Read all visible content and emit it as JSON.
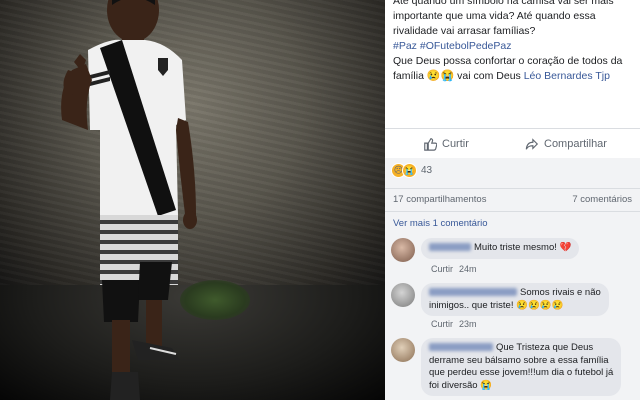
{
  "post": {
    "line1": "Até quando um símbolo na camisa vai ser mais",
    "line2": "importante que uma vida? Até quando essa",
    "line3": "rivalidade vai arrasar famílias?",
    "hashtags": "#Paz #OFutebolPedePaz",
    "line5": "Que Deus possa confortar o coração de todos da",
    "line6_prefix": "família",
    "line6_emojis": "😢😭",
    "line6_mid": " vai com Deus ",
    "mention": "Léo Bernardes Tjp"
  },
  "actions": {
    "comment_label": "Curtir",
    "share_label": "Compartilhar"
  },
  "reactions": {
    "icons": [
      "sad-face",
      "crying-face"
    ],
    "count": "43"
  },
  "stats": {
    "shares": "17 compartilhamentos",
    "comments": "7 comentários"
  },
  "more_comments": "Ver mais 1 comentário",
  "comments": [
    {
      "text": "Muito triste mesmo! 💔",
      "reply_label": "Curtir",
      "time": "24m"
    },
    {
      "text_line1": "Somos rivais e não",
      "text_line2": "inimigos.. que triste! 😢😢😢😢",
      "reply_label": "Curtir",
      "time": "23m"
    },
    {
      "text_line1": "Que Tristeza que Deus",
      "text_line2": "derrame seu bálsamo sobre a essa família",
      "text_line3": "que perdeu esse jovem!!!um dia o futebol já",
      "text_line4": "foi diversão 😭"
    }
  ],
  "colors": {
    "link": "#385898",
    "bubble": "#e4e6eb",
    "meta": "#606770",
    "sad": "#f7b125",
    "text": "#1c1e21"
  }
}
